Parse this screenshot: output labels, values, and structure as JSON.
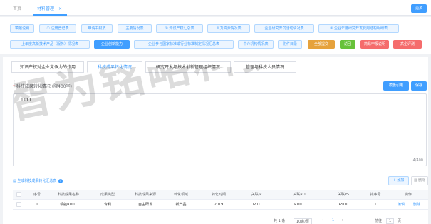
{
  "tabbar": {
    "tabs": [
      {
        "label": "首页",
        "active": false
      },
      {
        "label": "材料管理",
        "active": true
      }
    ],
    "close_glyph": "×",
    "more_label": "更多"
  },
  "modules": {
    "row1": [
      "填报说明",
      "① 注册登记表",
      "申请书封皮",
      "主要情况表",
      "② 知识产权汇总表",
      "人力资源情况表",
      "企业研究开发活动情况表",
      "③ 企业年度研究开发费用结构明细表"
    ],
    "row2": [
      "上年度高新技术产品（服务）情况表",
      "企业创新能力",
      "企业参与国家标准或行业标准制定情况汇总表",
      "中介机构情况表",
      "附件目录"
    ],
    "active": "企业创新能力",
    "actions": [
      {
        "label": "全部提交",
        "color": "#e6a23c"
      },
      {
        "label": "返回",
        "color": "#67c23a"
      },
      {
        "label": "简易申报说明",
        "color": "#f56c6c"
      },
      {
        "label": "高企评测",
        "color": "#f56c6c"
      }
    ]
  },
  "subtabs": [
    "知识产权对企业竞争力的作用",
    "科技成果转化情况",
    "研究开发与技术创新管理组织情况",
    "管理与科技人员情况"
  ],
  "active_subtab": "科技成果转化情况",
  "form": {
    "required_mark": "*",
    "field_label": "科技成果转化情况 (限400字)",
    "template_label": "模板引用",
    "save_label": "保存",
    "value": "1111",
    "count": "4/400"
  },
  "watermark": "智为铭略科技咨询",
  "summary": {
    "link_label": "生成科技成果转化汇总表",
    "add_label": "+ 添加",
    "delete_label": "删除"
  },
  "table": {
    "headers": [
      "序号",
      "科技成果名称",
      "成果类型",
      "科技成果来源",
      "转化领域",
      "转化时间",
      "关联IP",
      "关联RD",
      "关联PS",
      "排序号",
      "操作"
    ],
    "rows": [
      {
        "index": "1",
        "name": "领航RD01",
        "type": "专利",
        "source": "自主研发",
        "field": "新产品",
        "time": "2019",
        "ip": "IP01",
        "rd": "RD01",
        "ps": "PS01",
        "order": "1",
        "edit": "编辑",
        "delete": "删除"
      }
    ]
  },
  "pagination": {
    "total": "共 1 条",
    "page_size": "10条/页",
    "prev": "‹",
    "current": "1",
    "next": "›",
    "goto_label": "前往",
    "goto_value": "1",
    "page_suffix": "页"
  }
}
